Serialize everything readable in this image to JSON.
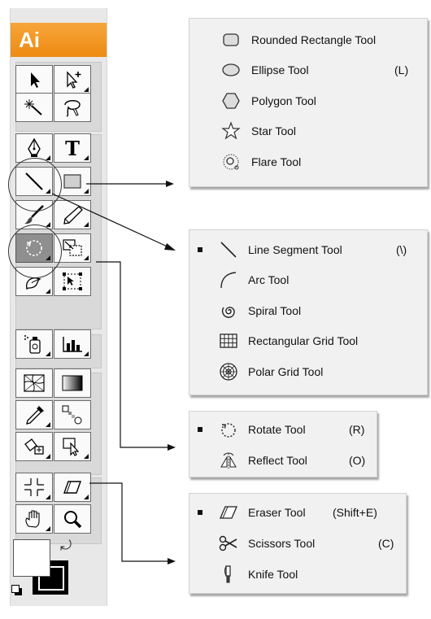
{
  "app": {
    "logo_text": "Ai"
  },
  "toolbox": {
    "tools": [
      {
        "name": "selection-tool-icon"
      },
      {
        "name": "direct-selection-tool-icon"
      },
      {
        "name": "magic-wand-tool-icon"
      },
      {
        "name": "lasso-tool-icon"
      },
      {
        "name": "pen-tool-icon"
      },
      {
        "name": "type-tool-icon"
      },
      {
        "name": "line-segment-tool-icon"
      },
      {
        "name": "rectangle-tool-icon"
      },
      {
        "name": "paintbrush-tool-icon"
      },
      {
        "name": "pencil-tool-icon"
      },
      {
        "name": "rotate-tool-icon"
      },
      {
        "name": "scale-tool-icon"
      },
      {
        "name": "warp-tool-icon"
      },
      {
        "name": "free-transform-tool-icon"
      },
      {
        "name": "symbol-sprayer-tool-icon"
      },
      {
        "name": "column-graph-tool-icon"
      },
      {
        "name": "mesh-tool-icon"
      },
      {
        "name": "gradient-tool-icon"
      },
      {
        "name": "eyedropper-tool-icon"
      },
      {
        "name": "blend-tool-icon"
      },
      {
        "name": "live-paint-bucket-tool-icon"
      },
      {
        "name": "live-paint-selection-tool-icon"
      },
      {
        "name": "slice-tool-icon"
      },
      {
        "name": "eraser-tool-icon"
      },
      {
        "name": "hand-tool-icon"
      },
      {
        "name": "zoom-tool-icon"
      }
    ],
    "fill_color": "#ffffff",
    "stroke_color": "#000000"
  },
  "flyouts": {
    "shapes": {
      "items": [
        {
          "label": "Rounded Rectangle Tool",
          "shortcut": "",
          "icon": "rounded-rectangle-icon",
          "selected": false
        },
        {
          "label": "Ellipse Tool",
          "shortcut": "(L)",
          "icon": "ellipse-icon",
          "selected": false
        },
        {
          "label": "Polygon Tool",
          "shortcut": "",
          "icon": "polygon-icon",
          "selected": false
        },
        {
          "label": "Star Tool",
          "shortcut": "",
          "icon": "star-icon",
          "selected": false
        },
        {
          "label": "Flare Tool",
          "shortcut": "",
          "icon": "flare-icon",
          "selected": false
        }
      ]
    },
    "lines": {
      "items": [
        {
          "label": "Line Segment Tool",
          "shortcut": "(\\)",
          "icon": "line-segment-icon",
          "selected": true
        },
        {
          "label": "Arc Tool",
          "shortcut": "",
          "icon": "arc-icon",
          "selected": false
        },
        {
          "label": "Spiral Tool",
          "shortcut": "",
          "icon": "spiral-icon",
          "selected": false
        },
        {
          "label": "Rectangular Grid Tool",
          "shortcut": "",
          "icon": "rectangular-grid-icon",
          "selected": false
        },
        {
          "label": "Polar Grid Tool",
          "shortcut": "",
          "icon": "polar-grid-icon",
          "selected": false
        }
      ]
    },
    "rotate": {
      "items": [
        {
          "label": "Rotate Tool",
          "shortcut": "(R)",
          "icon": "rotate-icon",
          "selected": true
        },
        {
          "label": "Reflect Tool",
          "shortcut": "(O)",
          "icon": "reflect-icon",
          "selected": false
        }
      ]
    },
    "eraser": {
      "items": [
        {
          "label": "Eraser Tool",
          "shortcut": "(Shift+E)",
          "icon": "eraser-icon",
          "selected": true
        },
        {
          "label": "Scissors Tool",
          "shortcut": "(C)",
          "icon": "scissors-icon",
          "selected": false
        },
        {
          "label": "Knife Tool",
          "shortcut": "",
          "icon": "knife-icon",
          "selected": false
        }
      ]
    }
  }
}
